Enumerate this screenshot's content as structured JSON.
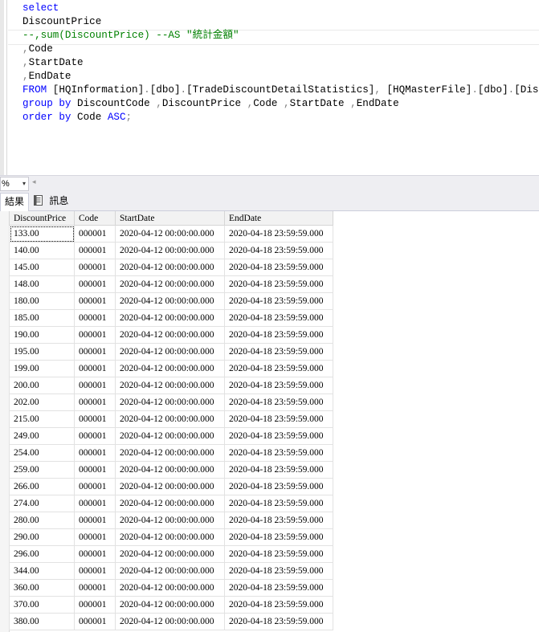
{
  "editor": {
    "lines": [
      [
        {
          "t": "select",
          "c": "kw"
        }
      ],
      [
        {
          "t": "DiscountPrice",
          "c": ""
        }
      ],
      [
        {
          "t": "--,sum(DiscountPrice) --AS \"統計金額\"",
          "c": "cm"
        }
      ],
      [
        {
          "t": ",",
          "c": "gr"
        },
        {
          "t": "Code",
          "c": ""
        }
      ],
      [
        {
          "t": ",",
          "c": "gr"
        },
        {
          "t": "StartDate",
          "c": ""
        }
      ],
      [
        {
          "t": ",",
          "c": "gr"
        },
        {
          "t": "EndDate",
          "c": ""
        }
      ],
      [
        {
          "t": "FROM",
          "c": "kw"
        },
        {
          "t": " [HQInformation]",
          "c": ""
        },
        {
          "t": ".",
          "c": "gr"
        },
        {
          "t": "[dbo]",
          "c": ""
        },
        {
          "t": ".",
          "c": "gr"
        },
        {
          "t": "[TradeDiscountDetailStatistics]",
          "c": ""
        },
        {
          "t": ",",
          "c": "gr"
        },
        {
          "t": " [HQMasterFile]",
          "c": ""
        },
        {
          "t": ".",
          "c": "gr"
        },
        {
          "t": "[dbo]",
          "c": ""
        },
        {
          "t": ".",
          "c": "gr"
        },
        {
          "t": "[Discount]",
          "c": ""
        }
      ],
      [
        {
          "t": "group by",
          "c": "kw"
        },
        {
          "t": " DiscountCode ",
          "c": ""
        },
        {
          "t": ",",
          "c": "gr"
        },
        {
          "t": "DiscountPrice ",
          "c": ""
        },
        {
          "t": ",",
          "c": "gr"
        },
        {
          "t": "Code ",
          "c": ""
        },
        {
          "t": ",",
          "c": "gr"
        },
        {
          "t": "StartDate ",
          "c": ""
        },
        {
          "t": ",",
          "c": "gr"
        },
        {
          "t": "EndDate",
          "c": ""
        }
      ],
      [
        {
          "t": "order by",
          "c": "kw"
        },
        {
          "t": " Code ",
          "c": ""
        },
        {
          "t": "ASC",
          "c": "kw"
        },
        {
          "t": ";",
          "c": "gr"
        }
      ]
    ]
  },
  "status": {
    "zoom": "%",
    "zoom_arrow": "▾",
    "scroll_left": "◂"
  },
  "tabs": {
    "results": "結果",
    "messages": "訊息"
  },
  "grid": {
    "columns": [
      "DiscountPrice",
      "Code",
      "StartDate",
      "EndDate"
    ],
    "rows": [
      [
        "133.00",
        "000001",
        "2020-04-12 00:00:00.000",
        "2020-04-18 23:59:59.000"
      ],
      [
        "140.00",
        "000001",
        "2020-04-12 00:00:00.000",
        "2020-04-18 23:59:59.000"
      ],
      [
        "145.00",
        "000001",
        "2020-04-12 00:00:00.000",
        "2020-04-18 23:59:59.000"
      ],
      [
        "148.00",
        "000001",
        "2020-04-12 00:00:00.000",
        "2020-04-18 23:59:59.000"
      ],
      [
        "180.00",
        "000001",
        "2020-04-12 00:00:00.000",
        "2020-04-18 23:59:59.000"
      ],
      [
        "185.00",
        "000001",
        "2020-04-12 00:00:00.000",
        "2020-04-18 23:59:59.000"
      ],
      [
        "190.00",
        "000001",
        "2020-04-12 00:00:00.000",
        "2020-04-18 23:59:59.000"
      ],
      [
        "195.00",
        "000001",
        "2020-04-12 00:00:00.000",
        "2020-04-18 23:59:59.000"
      ],
      [
        "199.00",
        "000001",
        "2020-04-12 00:00:00.000",
        "2020-04-18 23:59:59.000"
      ],
      [
        "200.00",
        "000001",
        "2020-04-12 00:00:00.000",
        "2020-04-18 23:59:59.000"
      ],
      [
        "202.00",
        "000001",
        "2020-04-12 00:00:00.000",
        "2020-04-18 23:59:59.000"
      ],
      [
        "215.00",
        "000001",
        "2020-04-12 00:00:00.000",
        "2020-04-18 23:59:59.000"
      ],
      [
        "249.00",
        "000001",
        "2020-04-12 00:00:00.000",
        "2020-04-18 23:59:59.000"
      ],
      [
        "254.00",
        "000001",
        "2020-04-12 00:00:00.000",
        "2020-04-18 23:59:59.000"
      ],
      [
        "259.00",
        "000001",
        "2020-04-12 00:00:00.000",
        "2020-04-18 23:59:59.000"
      ],
      [
        "266.00",
        "000001",
        "2020-04-12 00:00:00.000",
        "2020-04-18 23:59:59.000"
      ],
      [
        "274.00",
        "000001",
        "2020-04-12 00:00:00.000",
        "2020-04-18 23:59:59.000"
      ],
      [
        "280.00",
        "000001",
        "2020-04-12 00:00:00.000",
        "2020-04-18 23:59:59.000"
      ],
      [
        "290.00",
        "000001",
        "2020-04-12 00:00:00.000",
        "2020-04-18 23:59:59.000"
      ],
      [
        "296.00",
        "000001",
        "2020-04-12 00:00:00.000",
        "2020-04-18 23:59:59.000"
      ],
      [
        "344.00",
        "000001",
        "2020-04-12 00:00:00.000",
        "2020-04-18 23:59:59.000"
      ],
      [
        "360.00",
        "000001",
        "2020-04-12 00:00:00.000",
        "2020-04-18 23:59:59.000"
      ],
      [
        "370.00",
        "000001",
        "2020-04-12 00:00:00.000",
        "2020-04-18 23:59:59.000"
      ],
      [
        "380.00",
        "000001",
        "2020-04-12 00:00:00.000",
        "2020-04-18 23:59:59.000"
      ]
    ]
  }
}
